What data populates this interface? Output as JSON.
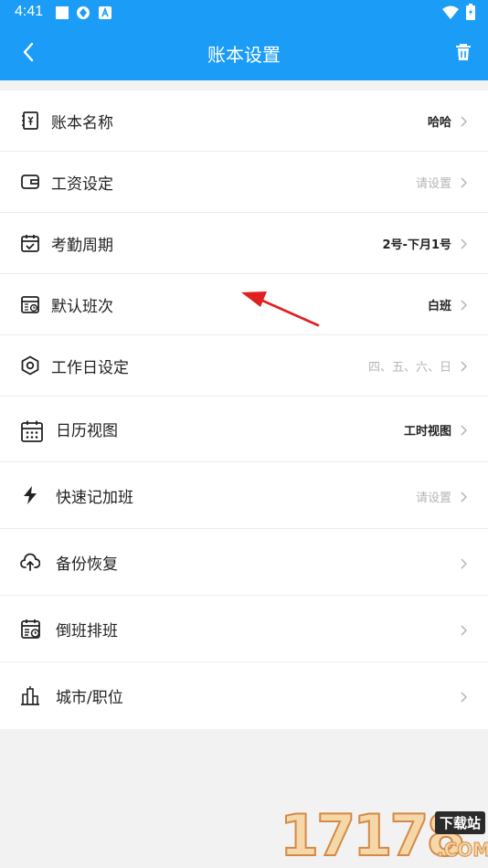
{
  "status_bar": {
    "time": "4:41"
  },
  "header": {
    "title": "账本设置",
    "back_icon": "chevron-left-icon",
    "delete_icon": "trash-icon"
  },
  "settings": [
    {
      "icon": "ledger-icon",
      "label": "账本名称",
      "value": "哈哈",
      "muted": false
    },
    {
      "icon": "wallet-icon",
      "label": "工资设定",
      "value": "请设置",
      "muted": true
    },
    {
      "icon": "calendar-check-icon",
      "label": "考勤周期",
      "value": "2号-下月1号",
      "muted": false
    },
    {
      "icon": "shift-calendar-icon",
      "label": "默认班次",
      "value": "白班",
      "muted": false
    },
    {
      "icon": "hexagon-nut-icon",
      "label": "工作日设定",
      "value": "四、五、六、日",
      "muted": true
    },
    {
      "icon": "calendar-grid-icon",
      "label": "日历视图",
      "value": "工时视图",
      "muted": false
    },
    {
      "icon": "lightning-icon",
      "label": "快速记加班",
      "value": "请设置",
      "muted": true
    },
    {
      "icon": "cloud-upload-icon",
      "label": "备份恢复",
      "value": "",
      "muted": false
    },
    {
      "icon": "calendar-clock-icon",
      "label": "倒班排班",
      "value": "",
      "muted": false
    },
    {
      "icon": "city-icon",
      "label": "城市/职位",
      "value": "",
      "muted": false
    }
  ],
  "watermark": {
    "digits": "17178",
    "badge": "下载站",
    "domain": ".COM"
  },
  "colors": {
    "primary": "#1a9cf7",
    "annotation_arrow": "#e02020"
  }
}
